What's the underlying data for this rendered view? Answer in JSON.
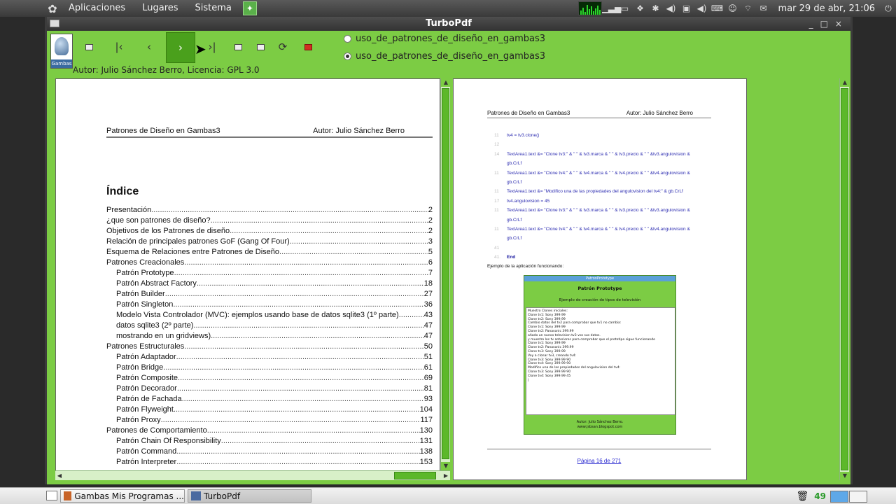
{
  "top_panel": {
    "menus": [
      "Aplicaciones",
      "Lugares",
      "Sistema"
    ],
    "clock": "mar 29 de abr, 21:06"
  },
  "window": {
    "title": "TurboPdf",
    "logo_label": "Gambas",
    "radio_options": [
      {
        "label": "uso_de_patrones_de_diseño_en_gambas3",
        "checked": false
      },
      {
        "label": "uso_de_patrones_de_diseño_en_gambas3",
        "checked": true
      }
    ],
    "author_line": "Autor: Julio Sánchez Berro, Licencia: GPL 3.0"
  },
  "left_page": {
    "header_title": "Patrones de Diseño en Gambas3",
    "header_author": "Autor: Julio Sánchez Berro",
    "section_title": "Índice",
    "toc": [
      {
        "title": "Presentación",
        "page": "2",
        "level": 0
      },
      {
        "title": "¿que son patrones de diseño?",
        "page": "2",
        "level": 0
      },
      {
        "title": "Objetivos de los Patrones de diseño",
        "page": "2",
        "level": 0
      },
      {
        "title": "Relación de principales patrones GoF (Gang Of Four)",
        "page": "3",
        "level": 0
      },
      {
        "title": "Esquema de Relaciones entre Patrones de Diseño",
        "page": "5",
        "level": 0
      },
      {
        "title": "Patrones Creacionales",
        "page": "6",
        "level": 0
      },
      {
        "title": "Patrón Prototype",
        "page": "7",
        "level": 1
      },
      {
        "title": "Patrón Abstract Factory",
        "page": "18",
        "level": 1
      },
      {
        "title": "Patrón Builder",
        "page": "27",
        "level": 1
      },
      {
        "title": "Patrón Singleton",
        "page": "36",
        "level": 1
      },
      {
        "title": "Modelo Vista Controlador (MVC): ejemplos usando base de datos sqlite3 (1º parte)",
        "page": "43",
        "level": 1
      },
      {
        "title": "datos sqlite3 (2º parte)",
        "page": "47",
        "level": 1
      },
      {
        "title": "mostrando en un gridviews)",
        "page": "47",
        "level": 1
      },
      {
        "title": "Patrones Estructurales",
        "page": "50",
        "level": 0
      },
      {
        "title": "Patrón Adaptador",
        "page": "51",
        "level": 1
      },
      {
        "title": "Patrón Bridge",
        "page": "61",
        "level": 1
      },
      {
        "title": "Patrón Composite",
        "page": "69",
        "level": 1
      },
      {
        "title": "Patrón Decorador",
        "page": "81",
        "level": 1
      },
      {
        "title": "Patrón de Fachada",
        "page": "93",
        "level": 1
      },
      {
        "title": "Patrón Flyweight",
        "page": "104",
        "level": 1
      },
      {
        "title": "Patrón Proxy",
        "page": "117",
        "level": 1
      },
      {
        "title": "Patrones de Comportamiento",
        "page": "130",
        "level": 0
      },
      {
        "title": "Patrón Chain Of Responsibility",
        "page": "131",
        "level": 1
      },
      {
        "title": "Patrón Command",
        "page": "138",
        "level": 1
      },
      {
        "title": "Patrón Interpreter",
        "page": "153",
        "level": 1
      }
    ]
  },
  "right_page": {
    "header_title": "Patrones de Diseño en Gambas3",
    "header_author": "Autor: Julio Sánchez Berro",
    "code_lines": [
      {
        "no": "11",
        "text": "tv4 = tv3.clone()"
      },
      {
        "no": "12",
        "text": ""
      },
      {
        "no": "14",
        "text": "TextArea1.text &= \"Clone tv3:\" & \" \" & tv3.marca & \" \" & tv3.precio & \" \" &tv3.angulovision &"
      },
      {
        "no": "",
        "text": "gb.CrLf"
      },
      {
        "no": "11",
        "text": "TextArea1.text &= \"Clone tv4:\" & \" \" & tv4.marca & \" \" & tv4.precio & \" \" &tv4.angulovision &"
      },
      {
        "no": "",
        "text": "gb.CrLf"
      },
      {
        "no": "11",
        "text": "TextArea1.text &= \"Modifico una de las propiedades del angulovision del tv4:\" & gb.CrLf"
      },
      {
        "no": "17",
        "text": "tv4.angulovision = 45"
      },
      {
        "no": "11",
        "text": "TextArea1.text &= \"Clone tv3:\" & \" \" & tv3.marca & \" \" & tv3.precio & \" \" &tv3.angulovision &"
      },
      {
        "no": "",
        "text": "gb.CrLf"
      },
      {
        "no": "11",
        "text": "TextArea1.text &= \"Clone tv4:\" & \" \" & tv4.marca & \" \" & tv4.precio & \" \" &tv4.angulovision &"
      },
      {
        "no": "",
        "text": "gb.CrLf"
      },
      {
        "no": "41",
        "text": ""
      },
      {
        "no": "41.",
        "text": "End"
      }
    ],
    "example_label": "Ejemplo de la aplicación funcionando:",
    "screenshot": {
      "window_title": "PatronPrototype",
      "heading": "Patrón Prototype",
      "subheading": "Ejemplo de creación de tipos de televisión",
      "output": "Muestro Clones iniciales:\nClone tv1: Sony 399.99\nClone tv2: Sony 399.99\nCambio datos del tv2 para comprobar que tv1 no cambia:\nClone tv1: Sony 399.99\nClone tv2: Panasonic 399.99\nañado un nuevo television tv3 vos sus datos.\ny muestro los tv anteriores para comprobar que el prototipo sigue funcionando\nClone tv1: Sony 399.99\nClone tv2: Panasonic 399.99\nClone tv3: Sony 399.99\nVoy a clonar tv3, creando tv4:\nClone tv3: Sony 399.99 90\nClone tv4: Sony 399.99 90\nModifico una de las propiedades del angulovision del tv4:\nClone tv3: Sony 399.99 90\nClone tv4: Sony 399.99 45\n|",
      "footer_author": "Autor: Julio Sánchez Berro.",
      "footer_blog": "www.jsbsan.blogspot.com"
    },
    "page_indicator": "Página 16 de 271"
  },
  "taskbar": {
    "tasks": [
      {
        "label": "Gambas Mis Programas ...",
        "active": false
      },
      {
        "label": "TurboPdf",
        "active": true
      }
    ],
    "counter": "49"
  },
  "colors": {
    "app_background": "#7ccc44",
    "active_button": "#4aa01c",
    "link": "#2b2bd0"
  }
}
